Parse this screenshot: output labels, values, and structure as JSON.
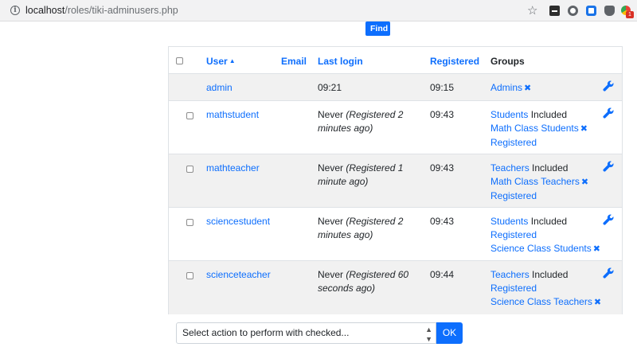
{
  "browser": {
    "url_host": "localhost",
    "url_path": "/roles/tiki-adminusers.php",
    "ext_badge": "1"
  },
  "find_label": "Find",
  "table": {
    "headers": {
      "user": "User",
      "email": "Email",
      "last_login": "Last login",
      "registered": "Registered",
      "groups": "Groups"
    },
    "rows": [
      {
        "user": "admin",
        "login_main": "09:21",
        "login_note": "",
        "registered": "09:15",
        "groups": [
          {
            "name": "Admins",
            "suffix": "",
            "removable": true
          }
        ]
      },
      {
        "user": "mathstudent",
        "login_main": "Never",
        "login_note": "(Registered 2 minutes ago)",
        "registered": "09:43",
        "groups": [
          {
            "name": "Students",
            "suffix": "Included",
            "removable": false
          },
          {
            "name": "Math Class Students",
            "suffix": "",
            "removable": true
          },
          {
            "name": "Registered",
            "suffix": "",
            "removable": false
          }
        ]
      },
      {
        "user": "mathteacher",
        "login_main": "Never",
        "login_note": "(Registered 1 minute ago)",
        "registered": "09:43",
        "groups": [
          {
            "name": "Teachers",
            "suffix": "Included",
            "removable": false
          },
          {
            "name": "Math Class Teachers",
            "suffix": "",
            "removable": true
          },
          {
            "name": "Registered",
            "suffix": "",
            "removable": false
          }
        ]
      },
      {
        "user": "sciencestudent",
        "login_main": "Never",
        "login_note": "(Registered 2 minutes ago)",
        "registered": "09:43",
        "groups": [
          {
            "name": "Students",
            "suffix": "Included",
            "removable": false
          },
          {
            "name": "Registered",
            "suffix": "",
            "removable": false
          },
          {
            "name": "Science Class Students",
            "suffix": "",
            "removable": true
          }
        ]
      },
      {
        "user": "scienceteacher",
        "login_main": "Never",
        "login_note": "(Registered 60 seconds ago)",
        "registered": "09:44",
        "groups": [
          {
            "name": "Teachers",
            "suffix": "Included",
            "removable": false
          },
          {
            "name": "Registered",
            "suffix": "",
            "removable": false
          },
          {
            "name": "Science Class Teachers",
            "suffix": "",
            "removable": true
          }
        ]
      }
    ]
  },
  "action_select_label": "Select action to perform with checked...",
  "ok_label": "OK",
  "colors": {
    "link": "#0d6efd",
    "row_shade": "#f1f1f1"
  }
}
